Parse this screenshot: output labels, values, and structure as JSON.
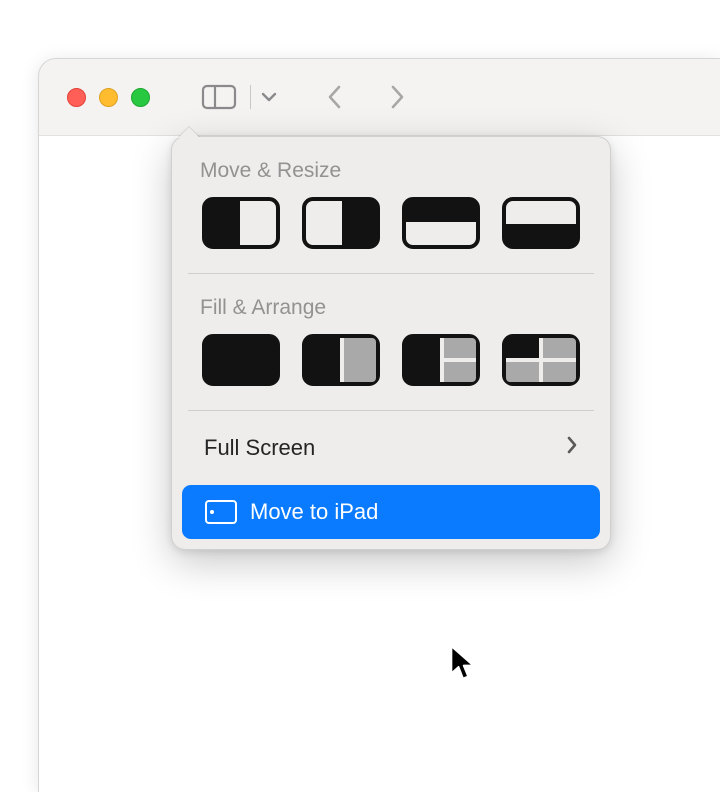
{
  "popover": {
    "section1_label": "Move & Resize",
    "section2_label": "Fill & Arrange",
    "full_screen_label": "Full Screen",
    "move_to_ipad_label": "Move to iPad"
  },
  "colors": {
    "selection": "#0a7bff"
  }
}
